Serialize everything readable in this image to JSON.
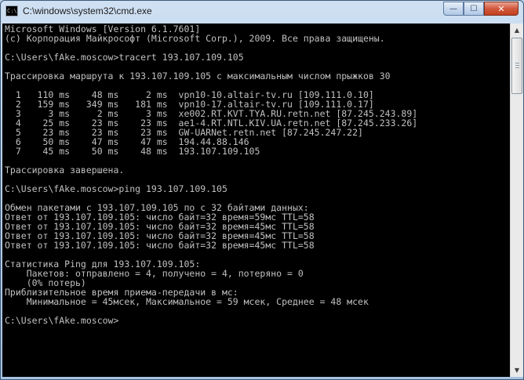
{
  "window": {
    "title": "C:\\windows\\system32\\cmd.exe",
    "icon_text": "C:\\"
  },
  "controls": {
    "minimize_glyph": "—",
    "maximize_glyph": "☐",
    "close_glyph": "✕"
  },
  "console": {
    "lines": [
      "Microsoft Windows [Version 6.1.7601]",
      "(c) Корпорация Майкрософт (Microsoft Corp.), 2009. Все права защищены.",
      "",
      "C:\\Users\\fAke.moscow>tracert 193.107.109.105",
      "",
      "Трассировка маршрута к 193.107.109.105 с максимальным числом прыжков 30",
      "",
      "  1   110 ms    48 ms     2 ms  vpn10-10.altair-tv.ru [109.111.0.10]",
      "  2   159 ms   349 ms   181 ms  vpn10-17.altair-tv.ru [109.111.0.17]",
      "  3     3 ms     2 ms     3 ms  xe002.RT.KVT.TYA.RU.retn.net [87.245.243.89]",
      "  4    25 ms    23 ms    23 ms  ae1-4.RT.NTL.KIV.UA.retn.net [87.245.233.26]",
      "  5    23 ms    23 ms    23 ms  GW-UARNet.retn.net [87.245.247.22]",
      "  6    50 ms    47 ms    47 ms  194.44.88.146",
      "  7    45 ms    50 ms    48 ms  193.107.109.105",
      "",
      "Трассировка завершена.",
      "",
      "C:\\Users\\fAke.moscow>ping 193.107.109.105",
      "",
      "Обмен пакетами с 193.107.109.105 по с 32 байтами данных:",
      "Ответ от 193.107.109.105: число байт=32 время=59мс TTL=58",
      "Ответ от 193.107.109.105: число байт=32 время=45мс TTL=58",
      "Ответ от 193.107.109.105: число байт=32 время=45мс TTL=58",
      "Ответ от 193.107.109.105: число байт=32 время=45мс TTL=58",
      "",
      "Статистика Ping для 193.107.109.105:",
      "    Пакетов: отправлено = 4, получено = 4, потеряно = 0",
      "    (0% потерь)",
      "Приблизительное время приема-передачи в мс:",
      "    Минимальное = 45мсек, Максимальное = 59 мсек, Среднее = 48 мсек",
      "",
      "C:\\Users\\fAke.moscow>"
    ]
  },
  "scrollbar": {
    "up_glyph": "▲",
    "down_glyph": "▼"
  }
}
